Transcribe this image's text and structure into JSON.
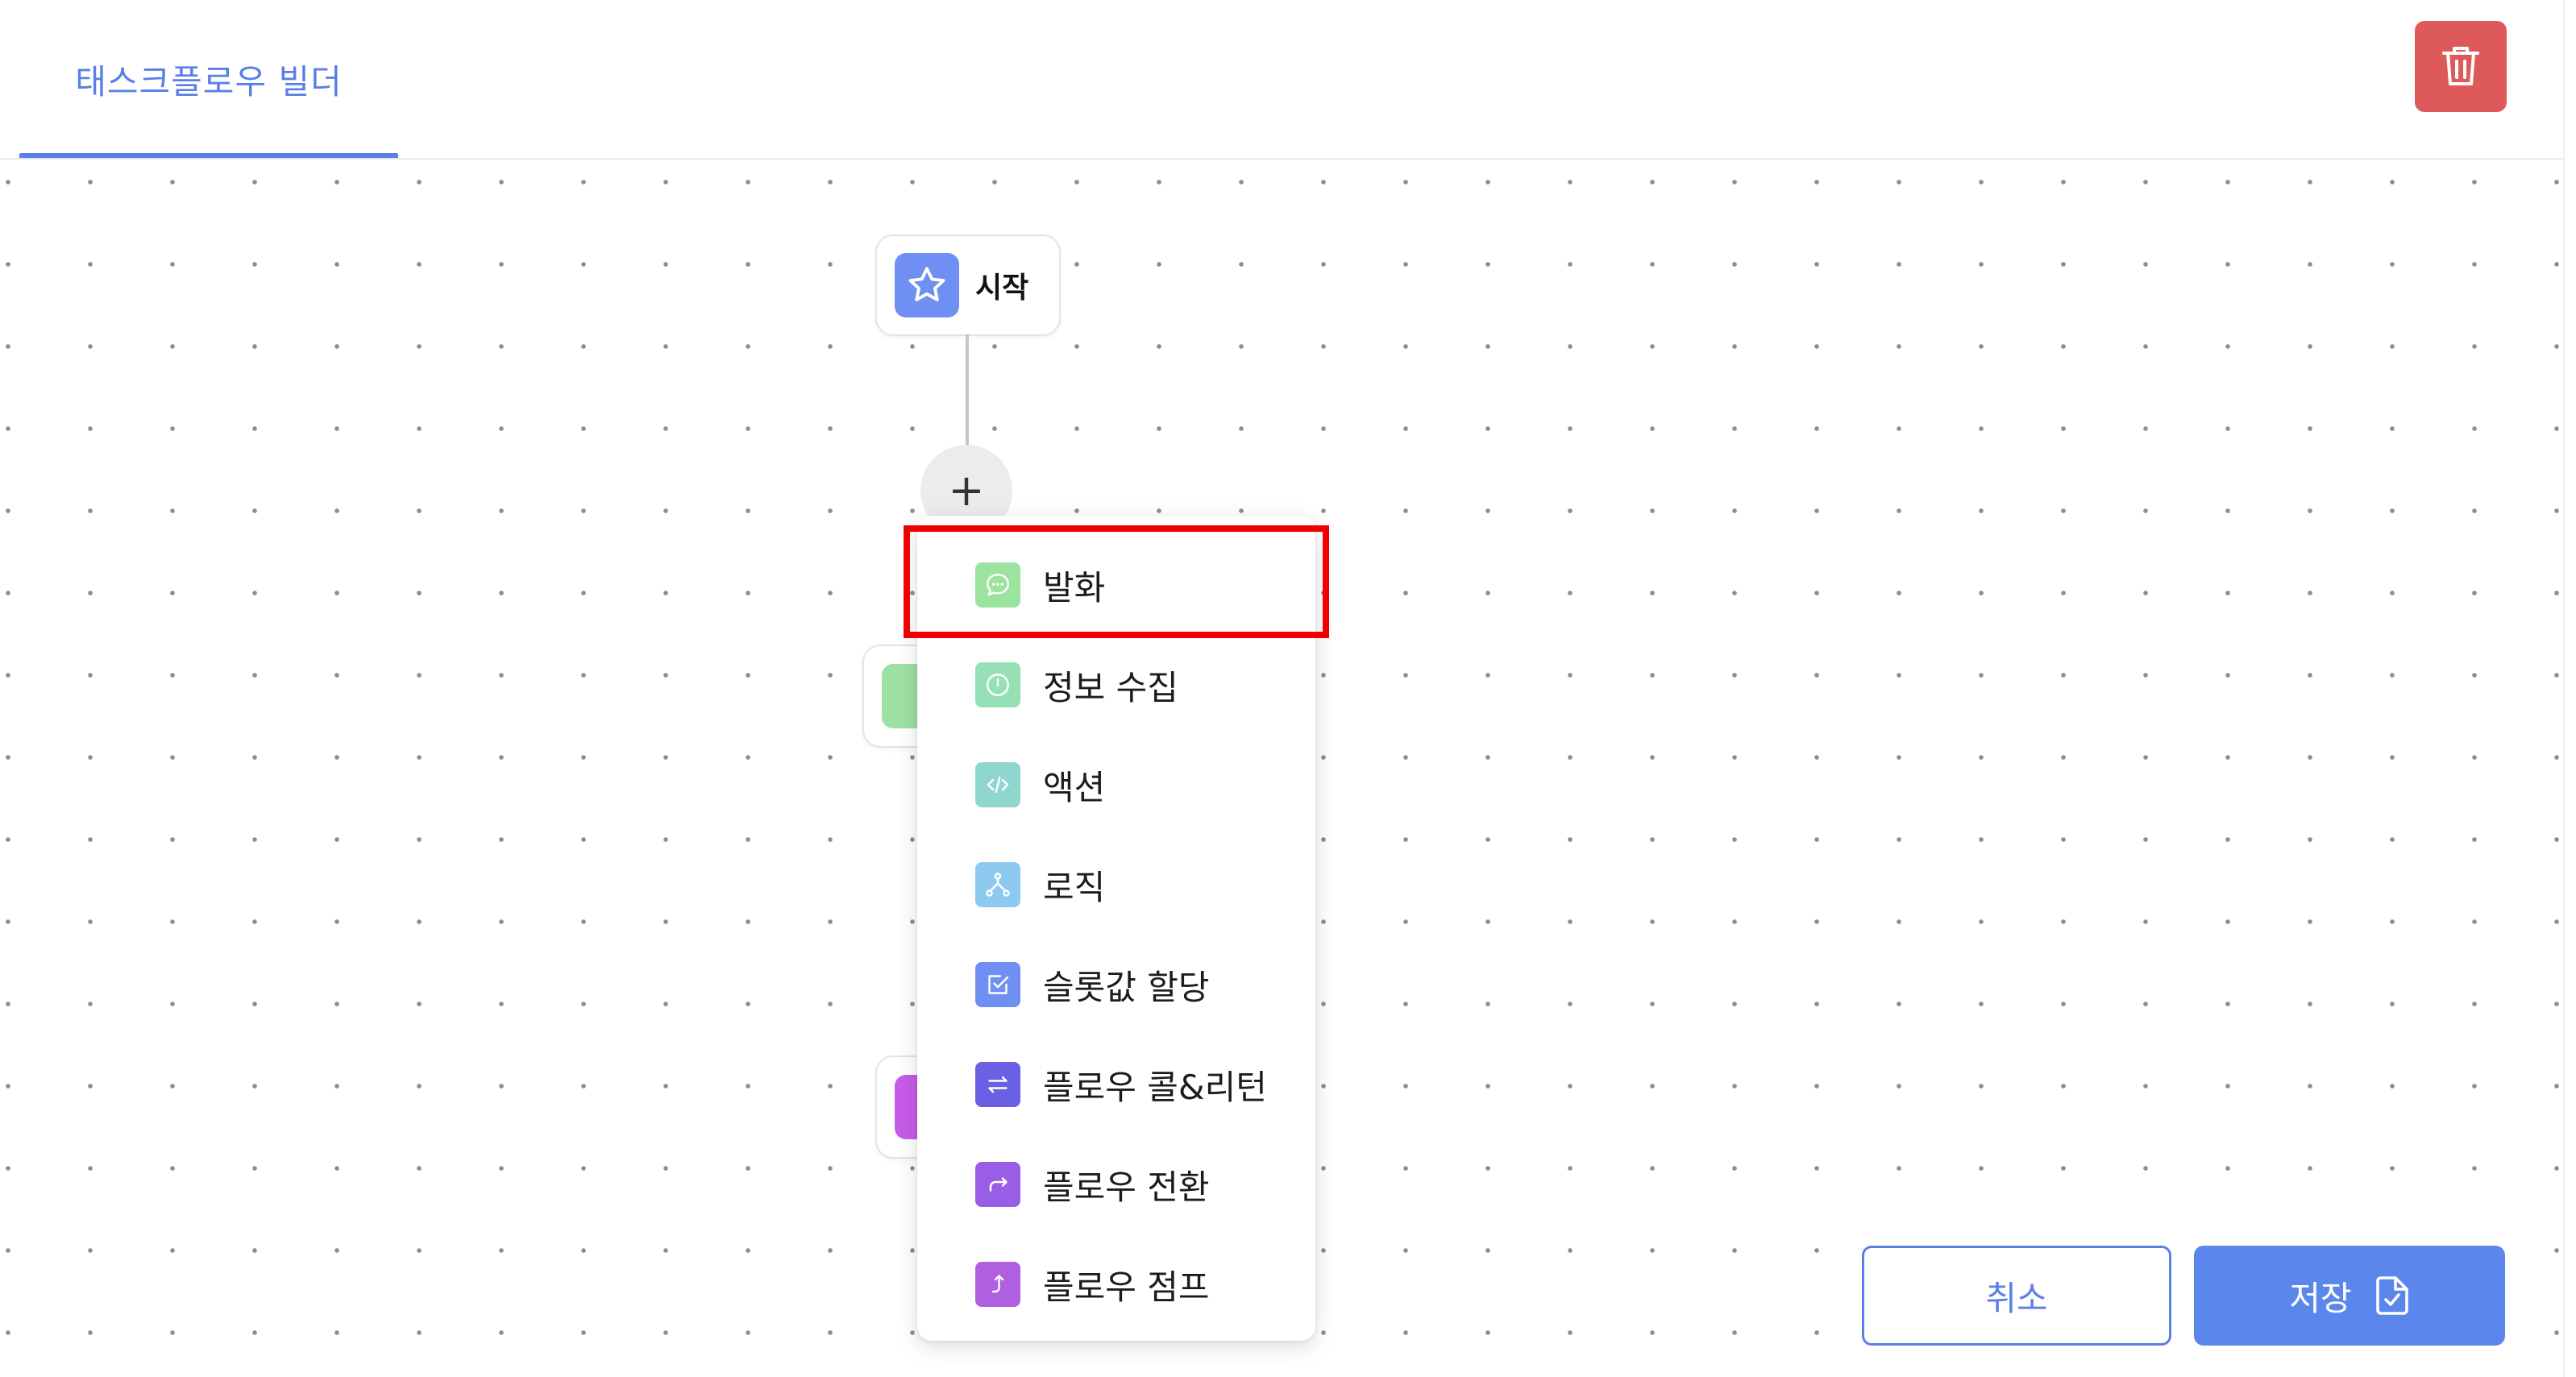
{
  "header": {
    "tab_label": "태스크플로우 빌더"
  },
  "canvas": {
    "start_node_label": "시작",
    "add_button_symbol": "+"
  },
  "menu": {
    "items": [
      {
        "label": "발화",
        "icon": "chat-bubble-icon",
        "color": "#9be39f"
      },
      {
        "label": "정보 수집",
        "icon": "clock-icon",
        "color": "#95e0b4"
      },
      {
        "label": "액션",
        "icon": "code-icon",
        "color": "#8fd6cf"
      },
      {
        "label": "로직",
        "icon": "branch-icon",
        "color": "#8ecaf0"
      },
      {
        "label": "슬롯값 할당",
        "icon": "checkbox-icon",
        "color": "#6f8ff2"
      },
      {
        "label": "플로우 콜&리턴",
        "icon": "swap-arrows-icon",
        "color": "#6b5fe4"
      },
      {
        "label": "플로우 전환",
        "icon": "redirect-arrow-icon",
        "color": "#9a5ee6"
      },
      {
        "label": "플로우 점프",
        "icon": "jump-arrow-icon",
        "color": "#b05fe0"
      }
    ],
    "highlighted_index": 0
  },
  "footer": {
    "cancel_label": "취소",
    "save_label": "저장"
  },
  "colors": {
    "accent": "#5b7fe6",
    "delete": "#de5a5a",
    "highlight": "#f00000"
  }
}
